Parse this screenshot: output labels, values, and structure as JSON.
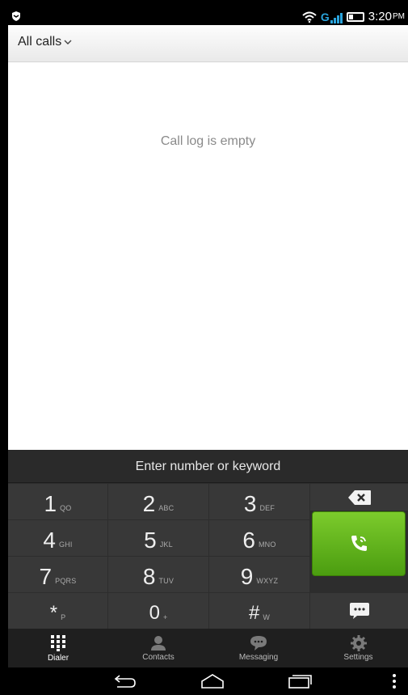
{
  "status_bar": {
    "time": "3:20",
    "ampm": "PM",
    "network": "G",
    "left_icon": "notification-shield-icon",
    "icons": [
      "wifi-icon",
      "signal-icon",
      "battery-icon"
    ]
  },
  "header": {
    "filter_label": "All calls",
    "filter_icon": "chevron-down-icon"
  },
  "call_log": {
    "empty_message": "Call log is empty"
  },
  "dialer": {
    "placeholder": "Enter number or keyword",
    "keys": [
      {
        "digit": "1",
        "letters": "QO"
      },
      {
        "digit": "2",
        "letters": "ABC"
      },
      {
        "digit": "3",
        "letters": "DEF"
      },
      {
        "digit": "4",
        "letters": "GHI"
      },
      {
        "digit": "5",
        "letters": "JKL"
      },
      {
        "digit": "6",
        "letters": "MNO"
      },
      {
        "digit": "7",
        "letters": "PQRS"
      },
      {
        "digit": "8",
        "letters": "TUV"
      },
      {
        "digit": "9",
        "letters": "WXYZ"
      },
      {
        "digit": "*",
        "letters": "P"
      },
      {
        "digit": "0",
        "letters": "+"
      },
      {
        "digit": "#",
        "letters": "W"
      }
    ],
    "accent_color": "#5fb21c"
  },
  "tabs": [
    {
      "label": "Dialer",
      "icon": "dialpad-icon",
      "active": true
    },
    {
      "label": "Contacts",
      "icon": "contacts-icon",
      "active": false
    },
    {
      "label": "Messaging",
      "icon": "messaging-icon",
      "active": false
    },
    {
      "label": "Settings",
      "icon": "settings-icon",
      "active": false
    }
  ],
  "nav": {
    "icons": [
      "back-icon",
      "home-icon",
      "recents-icon",
      "overflow-menu-icon"
    ]
  }
}
